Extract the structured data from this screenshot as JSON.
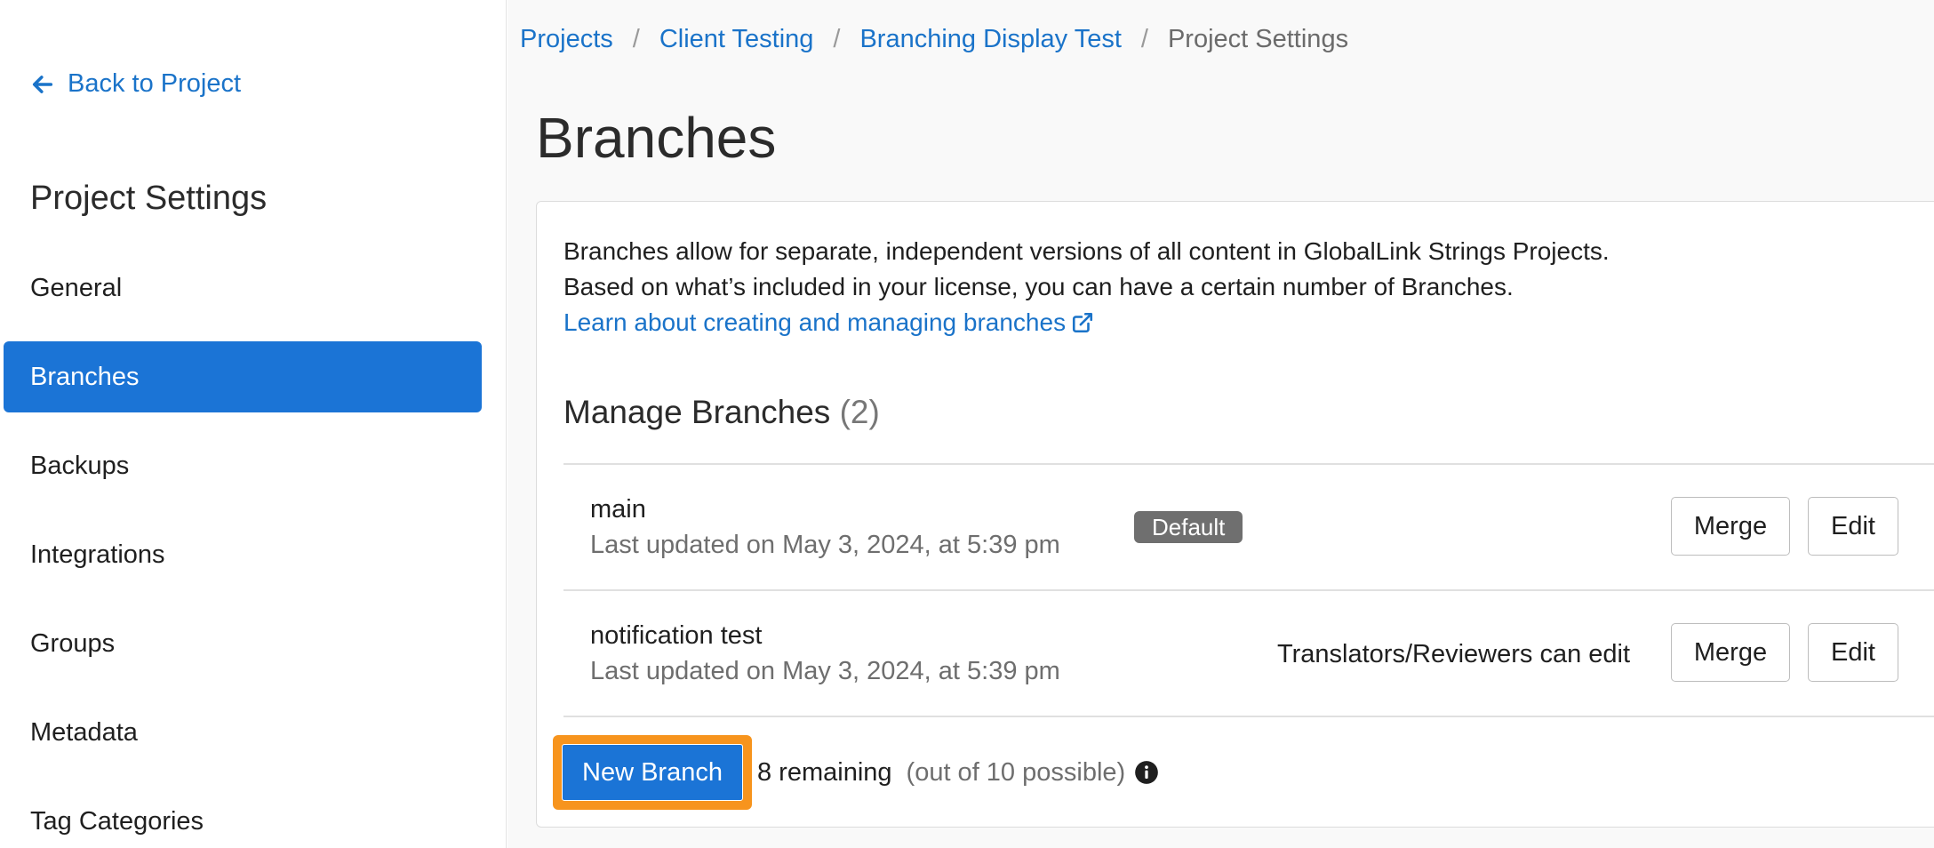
{
  "sidebar": {
    "back_label": "Back to Project",
    "title": "Project Settings",
    "items": [
      {
        "label": "General",
        "active": false
      },
      {
        "label": "Branches",
        "active": true
      },
      {
        "label": "Backups",
        "active": false
      },
      {
        "label": "Integrations",
        "active": false
      },
      {
        "label": "Groups",
        "active": false
      },
      {
        "label": "Metadata",
        "active": false
      },
      {
        "label": "Tag Categories",
        "active": false
      }
    ]
  },
  "breadcrumb": {
    "items": [
      "Projects",
      "Client Testing",
      "Branching Display Test"
    ],
    "current": "Project Settings",
    "separator": "/"
  },
  "page": {
    "title": "Branches",
    "description_line1": "Branches allow for separate, independent versions of all content in GlobalLink Strings Projects.",
    "description_line2": "Based on what’s included in your license, you can have a certain number of Branches.",
    "learn_link": "Learn about creating and managing branches"
  },
  "manage": {
    "title": "Manage Branches",
    "count": "(2)",
    "branches": [
      {
        "name": "main",
        "updated": "Last updated on May 3, 2024, at 5:39 pm",
        "badge": "Default",
        "merge_label": "Merge",
        "edit_label": "Edit"
      },
      {
        "name": "notification test",
        "updated": "Last updated on May 3, 2024, at 5:39 pm",
        "permission": "Translators/Reviewers can edit",
        "merge_label": "Merge",
        "edit_label": "Edit"
      }
    ],
    "new_branch_label": "New Branch",
    "remaining": "8 remaining",
    "possible": "(out of 10 possible)"
  },
  "icons": {
    "back": "arrow-left-icon",
    "external": "external-link-icon",
    "info": "info-circle-icon"
  },
  "colors": {
    "accent": "#1b74d6",
    "link": "#1a73c9",
    "highlight": "#f7941d",
    "badge": "#6f6f6f"
  }
}
